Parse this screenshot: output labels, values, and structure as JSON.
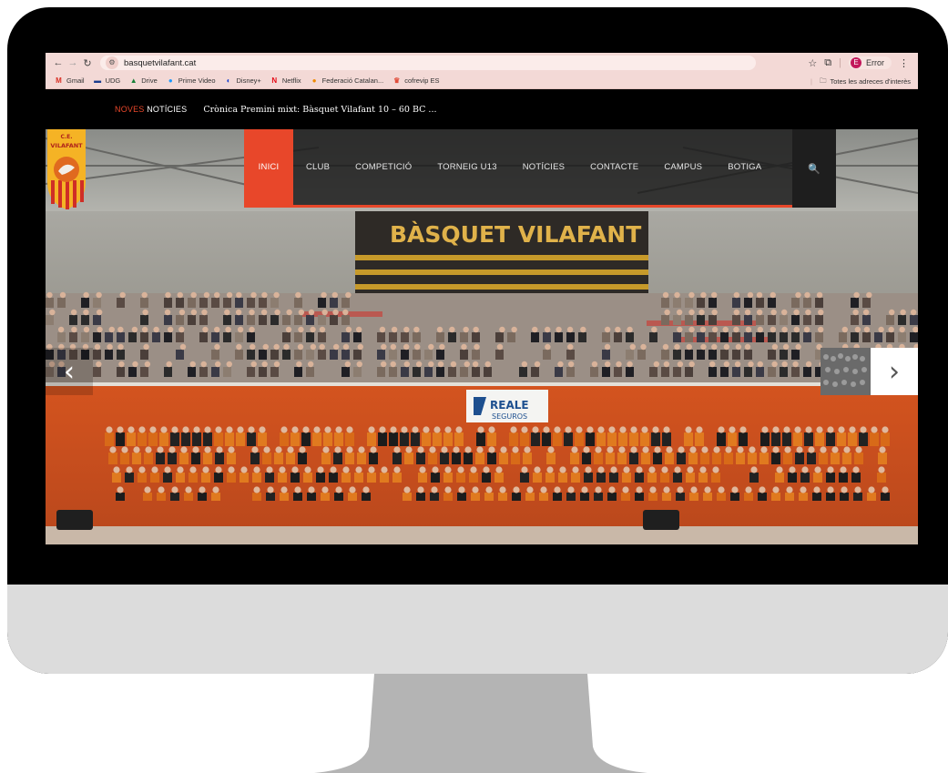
{
  "browser": {
    "url": "basquetvilafant.cat",
    "profile_label": "Error",
    "profile_initial": "E",
    "bookmarks": [
      {
        "label": "Gmail",
        "icon": "gmail-icon",
        "glyph": "M",
        "color": "#d93025"
      },
      {
        "label": "UDG",
        "icon": "udg-icon",
        "glyph": "▬",
        "color": "#1a3d8f"
      },
      {
        "label": "Drive",
        "icon": "drive-icon",
        "glyph": "▲",
        "color": "#188038"
      },
      {
        "label": "Prime Video",
        "icon": "prime-video-icon",
        "glyph": "●",
        "color": "#1a98ff"
      },
      {
        "label": "Disney+",
        "icon": "disney-icon",
        "glyph": "◐",
        "color": "#113ccf"
      },
      {
        "label": "Netflix",
        "icon": "netflix-icon",
        "glyph": "N",
        "color": "#e50914"
      },
      {
        "label": "Federació Catalan...",
        "icon": "federacio-icon",
        "glyph": "●",
        "color": "#f08a00"
      },
      {
        "label": "cofrevip ES",
        "icon": "cofrevip-icon",
        "glyph": "♛",
        "color": "#e04d3a"
      }
    ],
    "all_bookmarks_label": "Totes les adreces d'interès"
  },
  "site": {
    "ticker": {
      "label_red": "NOVES",
      "label_white": "NOTÍCIES",
      "headline": "Crònica Premini mixt: Bàsquet Vilafant 10 – 60 BC ..."
    },
    "logo": {
      "text_top": "C.E.",
      "text_name": "VILAFANT"
    },
    "menu": [
      {
        "label": "INICI",
        "active": true
      },
      {
        "label": "CLUB",
        "active": false
      },
      {
        "label": "COMPETICIÓ",
        "active": false
      },
      {
        "label": "TORNEIG U13",
        "active": false
      },
      {
        "label": "NOTÍCIES",
        "active": false
      },
      {
        "label": "CONTACTE",
        "active": false
      },
      {
        "label": "CAMPUS",
        "active": false
      },
      {
        "label": "BOTIGA",
        "active": false
      }
    ],
    "hero": {
      "banner_text": "BÀSQUET VILAFANT",
      "sponsor_line1": "REALE",
      "sponsor_line2": "SEGUROS"
    }
  },
  "colors": {
    "accent": "#e8472a",
    "chrome_bg": "#f3d9d6",
    "court_orange": "#d8531f"
  }
}
